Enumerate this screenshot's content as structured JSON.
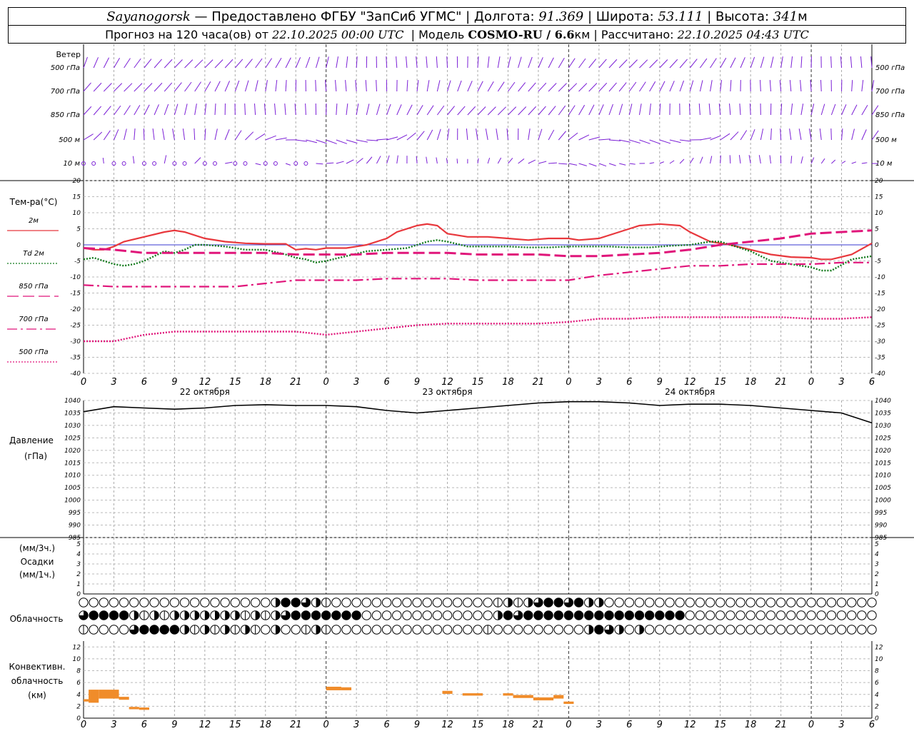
{
  "header": {
    "station": "Sayanogorsk",
    "dash": "—",
    "provider": "Предоставлено ФГБУ \"ЗапСиб УГМС\"",
    "lon_label": "Долгота:",
    "lon": "91.369",
    "lat_label": "Широта:",
    "lat": "53.111",
    "alt_label": "Высота:",
    "alt": "341",
    "alt_unit": "м",
    "forecast_prefix": "Прогноз на 120 часа(ов) от",
    "forecast_time": "22.10.2025 00:00 UTC",
    "model_label": "Модель",
    "model": "COSMO-RU / 6.6",
    "model_unit": "км",
    "calc_label": "Рассчитано:",
    "calc_time": "22.10.2025 04:43 UTC"
  },
  "chart_data": {
    "x_hours": [
      0,
      3,
      6,
      9,
      12,
      15,
      18,
      21,
      24,
      27,
      30,
      33,
      36,
      39,
      42,
      45,
      48,
      51,
      54,
      57,
      60,
      63,
      66,
      69,
      72,
      75,
      78
    ],
    "x_tick_labels": [
      "0",
      "3",
      "6",
      "9",
      "12",
      "15",
      "18",
      "21",
      "0",
      "3",
      "6",
      "9",
      "12",
      "15",
      "18",
      "21",
      "0",
      "3",
      "6",
      "9",
      "12",
      "15",
      "18",
      "21",
      "0",
      "3",
      "6"
    ],
    "date_labels": [
      "22 октября",
      "23 октября",
      "24 октября"
    ],
    "wind_panel": {
      "title": "Ветер",
      "levels": [
        "500 гПа",
        "700 гПа",
        "850 гПа",
        "500 м",
        "10 м"
      ],
      "color": "#7b1fd6"
    },
    "temperature_panel": {
      "type": "line",
      "ylabel": "Тем-ра(°C)",
      "ylim": [
        -40,
        20
      ],
      "yticks": [
        -40,
        -35,
        -30,
        -25,
        -20,
        -15,
        -10,
        -5,
        0,
        5,
        10,
        15,
        20
      ],
      "series": [
        {
          "name": "2м",
          "color": "#e8383d",
          "style": "solid",
          "x": [
            0,
            1,
            2,
            3,
            4,
            6,
            8,
            9,
            10,
            12,
            14,
            16,
            18,
            20,
            21,
            22,
            23,
            24,
            26,
            27,
            28,
            30,
            31,
            33,
            34,
            35,
            36,
            38,
            40,
            42,
            44,
            46,
            48,
            49,
            51,
            53,
            54,
            55,
            57,
            59,
            60,
            61,
            62,
            63,
            64,
            66,
            68,
            70,
            72,
            73,
            74,
            76,
            78
          ],
          "y": [
            -1,
            -1.5,
            -1.5,
            -0.5,
            1,
            2.5,
            4,
            4.5,
            4,
            2,
            1,
            0.5,
            0.3,
            0.3,
            -1.5,
            -1.2,
            -1.5,
            -1,
            -1,
            -0.5,
            0,
            2,
            4,
            6,
            6.5,
            6,
            3.5,
            2.5,
            2.5,
            2,
            1.5,
            2,
            2,
            1.5,
            2,
            4,
            5,
            6,
            6.5,
            6,
            4,
            2.5,
            1,
            0.5,
            0,
            -1.5,
            -3,
            -3.8,
            -4,
            -4.5,
            -4.5,
            -3,
            0.5
          ]
        },
        {
          "name": "Td 2м",
          "color": "#127a1c",
          "style": "dotted",
          "x": [
            0,
            1,
            2,
            3,
            4,
            5,
            6,
            7,
            8,
            9,
            10,
            11,
            12,
            14,
            16,
            18,
            20,
            21,
            22,
            23,
            24,
            26,
            28,
            30,
            32,
            33,
            34,
            35,
            36,
            38,
            40,
            42,
            44,
            46,
            48,
            50,
            52,
            54,
            56,
            58,
            60,
            62,
            63,
            64,
            66,
            68,
            70,
            72,
            73,
            74,
            76,
            78
          ],
          "y": [
            -4.5,
            -4,
            -5,
            -6,
            -6.5,
            -6,
            -5,
            -3.5,
            -2,
            -2.5,
            -1.5,
            0,
            0,
            -0.5,
            -1.5,
            -1.5,
            -3,
            -4,
            -4.5,
            -5.5,
            -5,
            -3.5,
            -2,
            -1.5,
            -1,
            0,
            1,
            1.5,
            1,
            -0.5,
            -0.5,
            -0.5,
            -0.8,
            -0.8,
            -0.5,
            -0.5,
            -0.5,
            -0.8,
            -0.8,
            -0.3,
            0,
            1,
            1,
            0,
            -2,
            -5,
            -6,
            -7,
            -8,
            -8,
            -4.5,
            -3.5
          ]
        },
        {
          "name": "850 гПа",
          "color": "#e0157a",
          "style": "longdash",
          "x": [
            0,
            3,
            6,
            9,
            12,
            15,
            18,
            21,
            24,
            27,
            30,
            33,
            36,
            39,
            42,
            45,
            48,
            51,
            54,
            57,
            60,
            63,
            66,
            69,
            72,
            75,
            78
          ],
          "y": [
            -1,
            -1.5,
            -2.5,
            -2.5,
            -2.5,
            -2.5,
            -2.5,
            -3,
            -3,
            -3,
            -2.5,
            -2.5,
            -2.5,
            -3,
            -3,
            -3,
            -3.5,
            -3.5,
            -3,
            -2.5,
            -1.5,
            0,
            1,
            2,
            3.5,
            4,
            4.5
          ]
        },
        {
          "name": "700 гПа",
          "color": "#e0157a",
          "style": "dashdot",
          "x": [
            0,
            3,
            6,
            9,
            12,
            15,
            18,
            21,
            24,
            27,
            30,
            33,
            36,
            39,
            42,
            45,
            48,
            51,
            54,
            57,
            60,
            63,
            66,
            69,
            72,
            75,
            78
          ],
          "y": [
            -12.5,
            -13,
            -13,
            -13,
            -13,
            -13,
            -12,
            -11,
            -11,
            -11,
            -10.5,
            -10.5,
            -10.5,
            -11,
            -11,
            -11,
            -11,
            -9.5,
            -8.5,
            -7.5,
            -6.5,
            -6.5,
            -6,
            -6,
            -6,
            -5.5,
            -5.5
          ]
        },
        {
          "name": "500 гПа",
          "color": "#e0157a",
          "style": "dotted",
          "x": [
            0,
            3,
            6,
            9,
            12,
            15,
            18,
            21,
            24,
            27,
            30,
            33,
            36,
            39,
            42,
            45,
            48,
            51,
            54,
            57,
            60,
            63,
            66,
            69,
            72,
            75,
            78
          ],
          "y": [
            -30,
            -30,
            -28,
            -27,
            -27,
            -27,
            -27,
            -27,
            -28,
            -27,
            -26,
            -25,
            -24.5,
            -24.5,
            -24.5,
            -24.5,
            -24,
            -23,
            -23,
            -22.5,
            -22.5,
            -22.5,
            -22.5,
            -22.5,
            -23,
            -23,
            -22.5
          ]
        }
      ]
    },
    "pressure_panel": {
      "type": "line",
      "ylabel": "Давление",
      "yunit": "(гПа)",
      "ylim": [
        985,
        1040
      ],
      "yticks": [
        985,
        990,
        995,
        1000,
        1005,
        1010,
        1015,
        1020,
        1025,
        1030,
        1035,
        1040
      ],
      "series": [
        {
          "name": "pressure",
          "color": "#000000",
          "x": [
            0,
            3,
            6,
            9,
            12,
            15,
            18,
            21,
            24,
            27,
            30,
            33,
            36,
            39,
            42,
            45,
            48,
            51,
            54,
            57,
            60,
            63,
            66,
            69,
            72,
            75,
            78
          ],
          "y": [
            1035.5,
            1037.5,
            1037,
            1036.5,
            1037,
            1038,
            1038.3,
            1038,
            1038,
            1037.5,
            1036,
            1035,
            1036,
            1037,
            1038,
            1039,
            1039.5,
            1039.5,
            1039,
            1038,
            1038.5,
            1038.5,
            1038,
            1037,
            1036,
            1035,
            1031
          ]
        }
      ]
    },
    "precip_panel": {
      "type": "bar",
      "ylabel_1": "(мм/3ч.)",
      "ylabel_2": "Осадки",
      "ylabel_3": "(мм/1ч.)",
      "ylim": [
        0,
        5
      ],
      "yticks": [
        0,
        1,
        2,
        3,
        4,
        5
      ],
      "values": []
    },
    "cloud_panel": {
      "title": "Облачность",
      "step_hours": 1,
      "rows": [
        [
          0,
          0,
          0,
          0,
          0,
          0,
          0,
          0,
          0,
          0,
          0,
          0,
          0,
          0,
          0,
          0,
          0,
          0,
          0,
          2,
          4,
          4,
          3,
          2,
          1,
          0,
          0,
          0,
          0,
          0,
          0,
          0,
          0,
          0,
          0,
          0,
          0,
          0,
          0,
          0,
          0,
          1,
          2,
          1,
          2,
          3,
          4,
          4,
          3,
          4,
          2,
          2,
          0,
          0,
          0,
          0,
          0,
          0,
          0,
          0,
          0,
          0,
          0,
          0,
          0,
          0,
          0,
          0,
          0,
          0,
          0,
          0,
          0,
          0,
          0,
          0,
          0,
          0,
          0,
          0,
          0
        ],
        [
          3,
          4,
          4,
          4,
          4,
          2,
          1,
          2,
          1,
          2,
          2,
          2,
          2,
          2,
          2,
          2,
          1,
          2,
          1,
          2,
          3,
          4,
          4,
          4,
          4,
          4,
          4,
          4,
          0,
          0,
          0,
          0,
          0,
          0,
          0,
          0,
          0,
          0,
          0,
          0,
          0,
          2,
          4,
          3,
          4,
          4,
          4,
          4,
          4,
          4,
          4,
          4,
          4,
          4,
          4,
          4,
          4,
          4,
          4,
          4,
          0,
          0,
          0,
          0,
          0,
          0,
          0,
          0,
          0,
          0,
          0,
          0,
          0,
          0,
          0,
          0,
          0,
          0,
          0,
          0,
          0
        ],
        [
          1,
          0,
          0,
          0,
          0,
          3,
          4,
          4,
          4,
          4,
          2,
          1,
          2,
          1,
          2,
          1,
          2,
          1,
          0,
          2,
          0,
          0,
          1,
          2,
          1,
          0,
          0,
          0,
          0,
          0,
          0,
          0,
          0,
          0,
          0,
          0,
          0,
          0,
          0,
          0,
          1,
          0,
          0,
          0,
          0,
          0,
          0,
          0,
          0,
          0,
          2,
          4,
          3,
          2,
          0,
          2,
          0,
          0,
          0,
          0,
          0,
          0,
          0,
          0,
          0,
          0,
          0,
          0,
          0,
          0,
          0,
          0,
          0,
          0,
          0,
          0,
          0,
          0,
          0,
          0,
          0
        ]
      ]
    },
    "convective_panel": {
      "type": "bar",
      "ylabel_1": "Конвективн.",
      "ylabel_2": "облачность",
      "ylabel_3": "(км)",
      "ylim": [
        0,
        13
      ],
      "yticks": [
        0,
        2,
        4,
        6,
        8,
        10,
        12
      ],
      "color": "#f08c2a",
      "bars": [
        {
          "x0": 0,
          "x1": 0.5,
          "y0": 2.8,
          "y1": 3.2
        },
        {
          "x0": 0.5,
          "x1": 1.5,
          "y0": 2.6,
          "y1": 4.8
        },
        {
          "x0": 1.5,
          "x1": 3.5,
          "y0": 3.3,
          "y1": 4.8
        },
        {
          "x0": 3.5,
          "x1": 4.5,
          "y0": 3.1,
          "y1": 3.6
        },
        {
          "x0": 4.5,
          "x1": 5.5,
          "y0": 1.5,
          "y1": 1.9
        },
        {
          "x0": 5.5,
          "x1": 6.5,
          "y0": 1.4,
          "y1": 1.8
        },
        {
          "x0": 24,
          "x1": 25.5,
          "y0": 4.7,
          "y1": 5.3
        },
        {
          "x0": 25.5,
          "x1": 26.5,
          "y0": 4.7,
          "y1": 5.2
        },
        {
          "x0": 35.5,
          "x1": 36.5,
          "y0": 4.1,
          "y1": 4.6
        },
        {
          "x0": 37.5,
          "x1": 39.5,
          "y0": 3.8,
          "y1": 4.2
        },
        {
          "x0": 41.5,
          "x1": 42.5,
          "y0": 3.8,
          "y1": 4.2
        },
        {
          "x0": 42.5,
          "x1": 44.5,
          "y0": 3.4,
          "y1": 3.9
        },
        {
          "x0": 44.5,
          "x1": 46.5,
          "y0": 3.0,
          "y1": 3.5
        },
        {
          "x0": 46.5,
          "x1": 47.5,
          "y0": 3.3,
          "y1": 3.9
        },
        {
          "x0": 47.5,
          "x1": 48.5,
          "y0": 2.4,
          "y1": 2.8
        }
      ]
    }
  }
}
